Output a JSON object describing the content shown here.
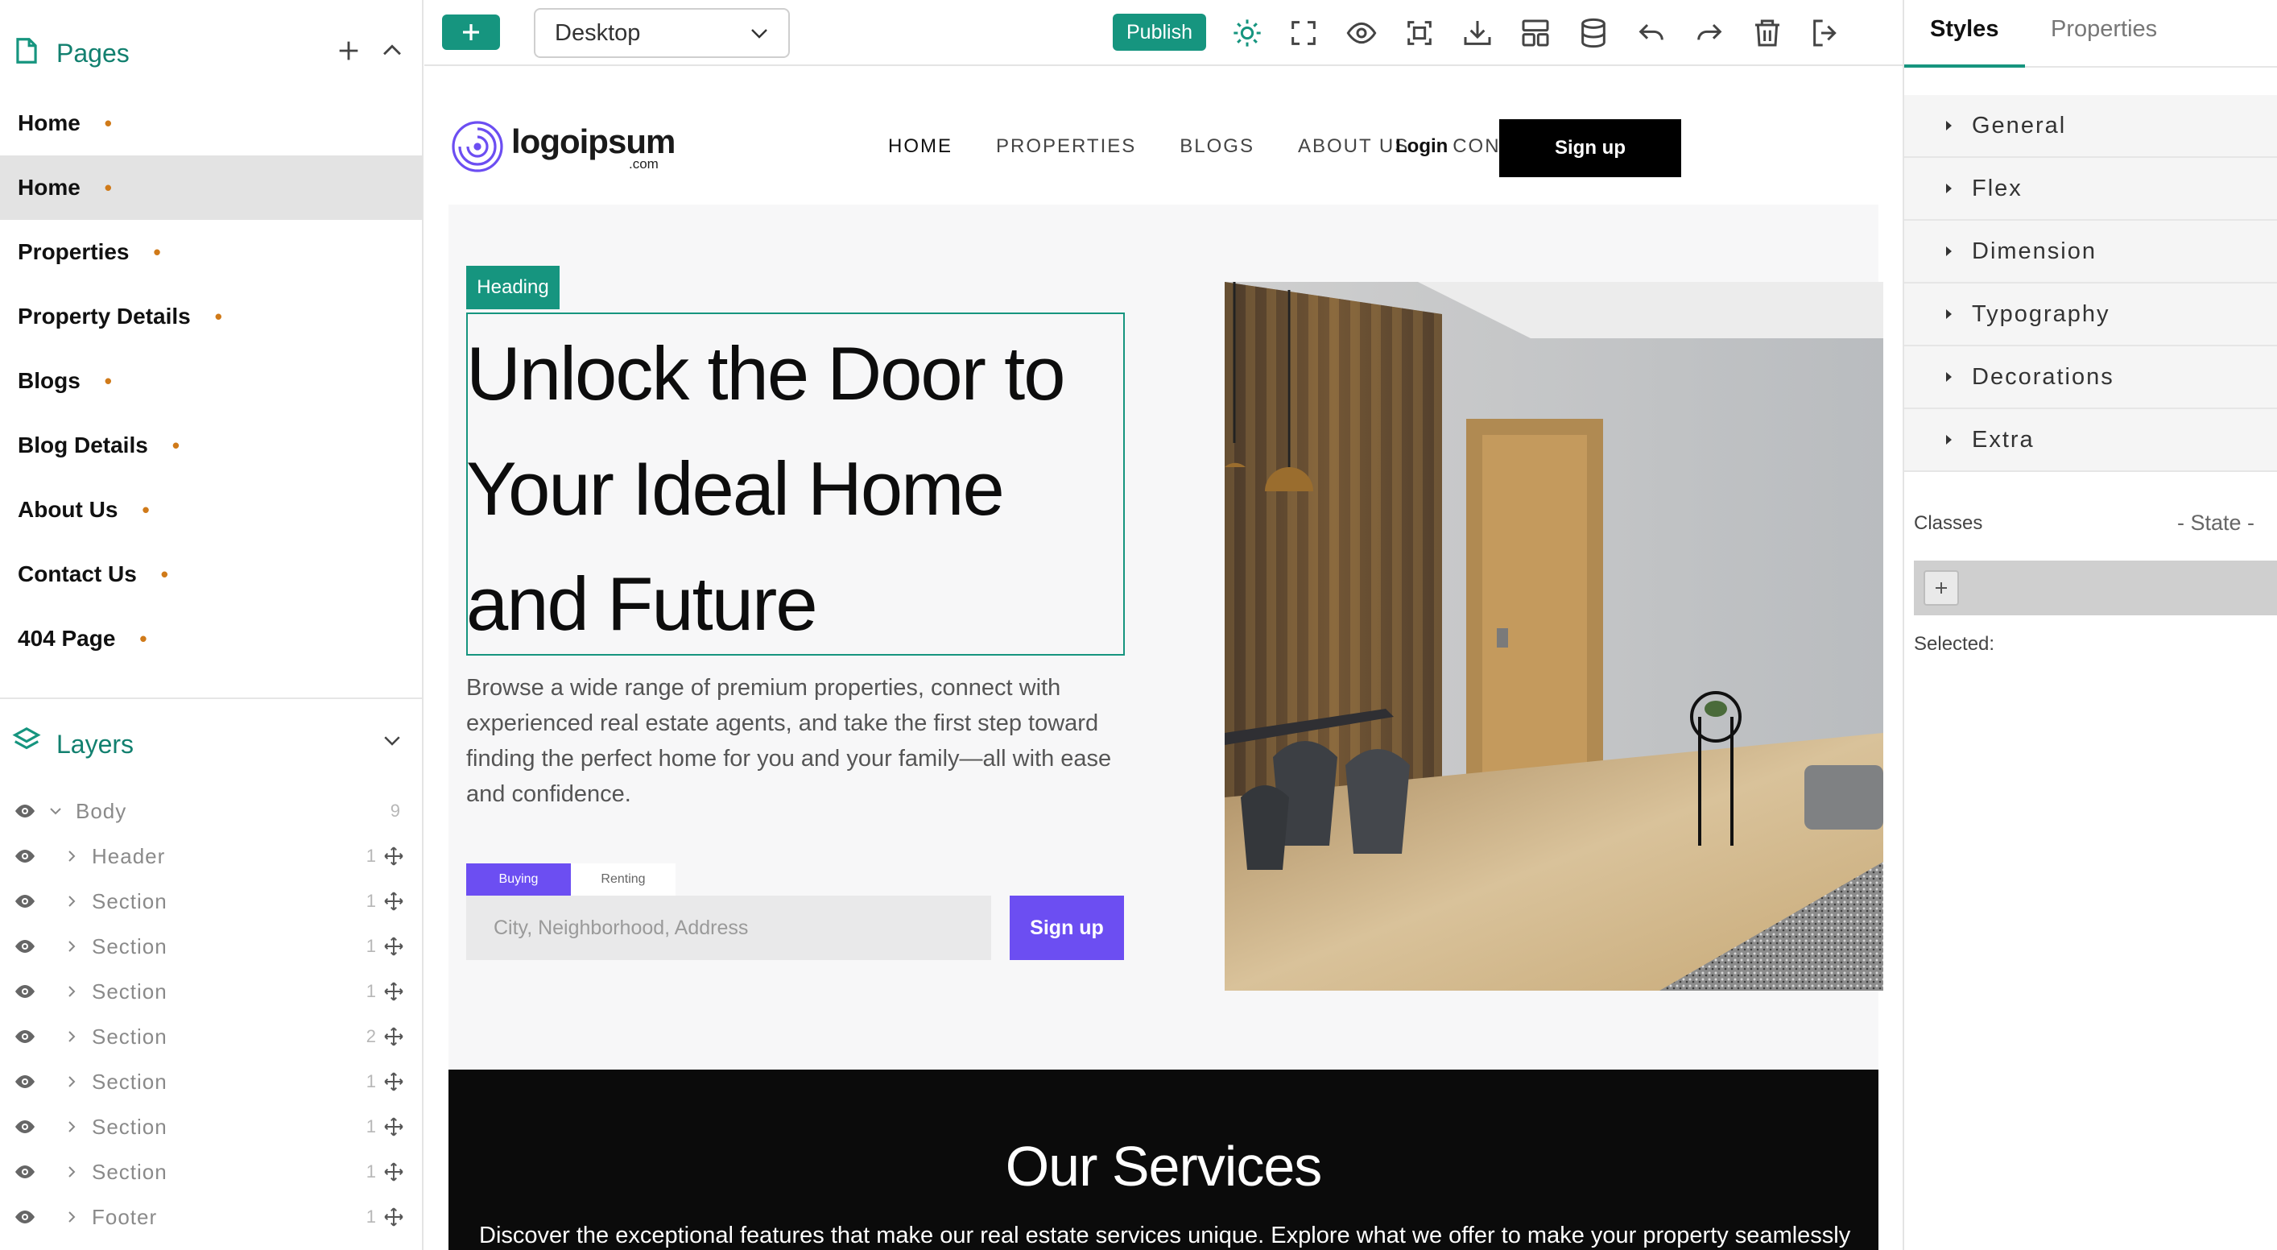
{
  "left_panel": {
    "pages_title": "Pages",
    "pages": [
      {
        "label": "Home",
        "active": false
      },
      {
        "label": "Home",
        "active": true
      },
      {
        "label": "Properties",
        "active": false
      },
      {
        "label": "Property Details",
        "active": false
      },
      {
        "label": "Blogs",
        "active": false
      },
      {
        "label": "Blog Details",
        "active": false
      },
      {
        "label": "About Us",
        "active": false
      },
      {
        "label": "Contact Us",
        "active": false
      },
      {
        "label": "404 Page",
        "active": false
      }
    ],
    "page_dot": "•",
    "layers_title": "Layers",
    "layers": [
      {
        "label": "Body",
        "count": "9",
        "level": "body"
      },
      {
        "label": "Header",
        "count": "1",
        "level": "child"
      },
      {
        "label": "Section",
        "count": "1",
        "level": "child"
      },
      {
        "label": "Section",
        "count": "1",
        "level": "child"
      },
      {
        "label": "Section",
        "count": "1",
        "level": "child"
      },
      {
        "label": "Section",
        "count": "2",
        "level": "child"
      },
      {
        "label": "Section",
        "count": "1",
        "level": "child"
      },
      {
        "label": "Section",
        "count": "1",
        "level": "child"
      },
      {
        "label": "Section",
        "count": "1",
        "level": "child"
      },
      {
        "label": "Footer",
        "count": "1",
        "level": "child"
      }
    ]
  },
  "toolbar": {
    "device": "Desktop",
    "publish_label": "Publish",
    "icons": [
      "sun-icon",
      "fullscreen-icon",
      "preview-eye-icon",
      "code-view-icon",
      "download-icon",
      "layout-icon",
      "database-icon",
      "undo-icon",
      "redo-icon",
      "trash-icon",
      "exit-icon"
    ]
  },
  "right_panel": {
    "tabs": [
      "Styles",
      "Properties"
    ],
    "sectors": [
      "General",
      "Flex",
      "Dimension",
      "Typography",
      "Decorations",
      "Extra"
    ],
    "classes_label": "Classes",
    "state_label": "- State -",
    "selected_label": "Selected:"
  },
  "site": {
    "logo_text": "logoipsum",
    "logo_sub": ".com",
    "nav": [
      "HOME",
      "PROPERTIES",
      "BLOGS",
      "ABOUT US",
      "CONTACT US"
    ],
    "login": "Login",
    "signup": "Sign up",
    "heading_tag": "Heading",
    "hero_title": "Unlock the Door to Your Ideal Home and Future",
    "hero_desc": "Browse a wide range of premium properties, connect with experienced real estate agents, and take the first step toward finding the perfect home for you and your family—all with ease and confidence.",
    "tab_buying": "Buying",
    "tab_renting": "Renting",
    "search_placeholder": "City, Neighborhood, Address",
    "hero_signup": "Sign up",
    "services_title": "Our Services",
    "services_desc": "Discover the exceptional features that make our real estate services unique. Explore what we offer to make your property seamlessly"
  },
  "colors": {
    "accent_teal": "#16957f",
    "accent_purple": "#6c4ef2",
    "page_dot": "#d07a19"
  }
}
